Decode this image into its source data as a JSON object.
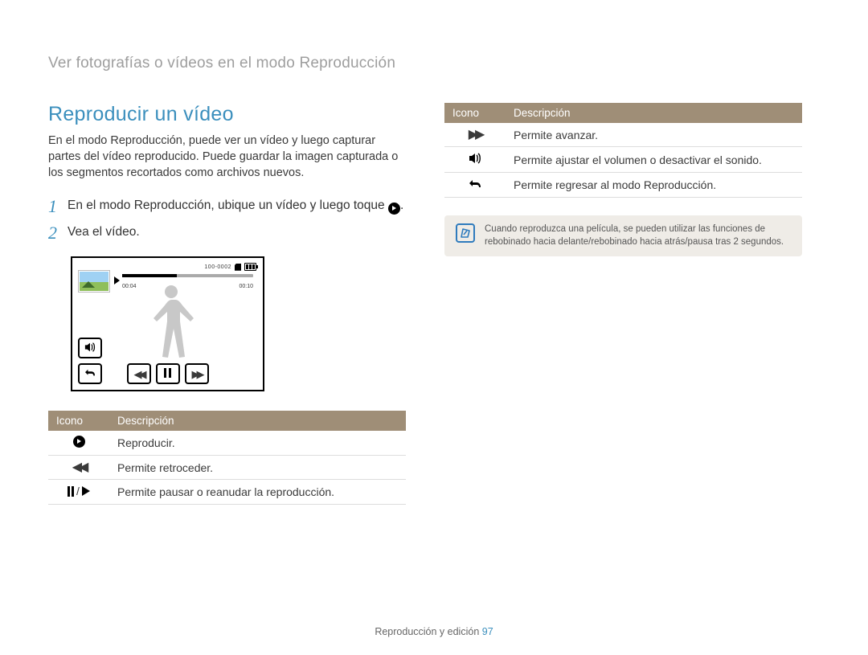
{
  "breadcrumb": "Ver fotografías o vídeos en el modo Reproducción",
  "section_title": "Reproducir un vídeo",
  "intro": "En el modo Reproducción, puede ver un vídeo y luego capturar partes del vídeo reproducido. Puede guardar la imagen capturada o los segmentos recortados como archivos nuevos.",
  "steps": {
    "s1_a": "En el modo Reproducción, ubique un vídeo y luego toque ",
    "s1_b": ".",
    "s2": "Vea el vídeo."
  },
  "screen": {
    "file_no": "100-0002",
    "time_elapsed": "00:04",
    "time_total": "00:10"
  },
  "table": {
    "icon_hdr": "Icono",
    "desc_hdr": "Descripción"
  },
  "left_rows": {
    "play": "Reproducir.",
    "rewind": "Permite retroceder.",
    "pause_resume": "Permite pausar o reanudar la reproducción."
  },
  "right_rows": {
    "forward": "Permite avanzar.",
    "volume": "Permite ajustar el volumen o desactivar el sonido.",
    "back": "Permite regresar al modo Reproducción."
  },
  "note": "Cuando reproduzca una película, se pueden utilizar las funciones de rebobinado hacia delante/rebobinado hacia atrás/pausa tras 2 segundos.",
  "footer": {
    "label": "Reproducción y edición  ",
    "page": "97"
  }
}
